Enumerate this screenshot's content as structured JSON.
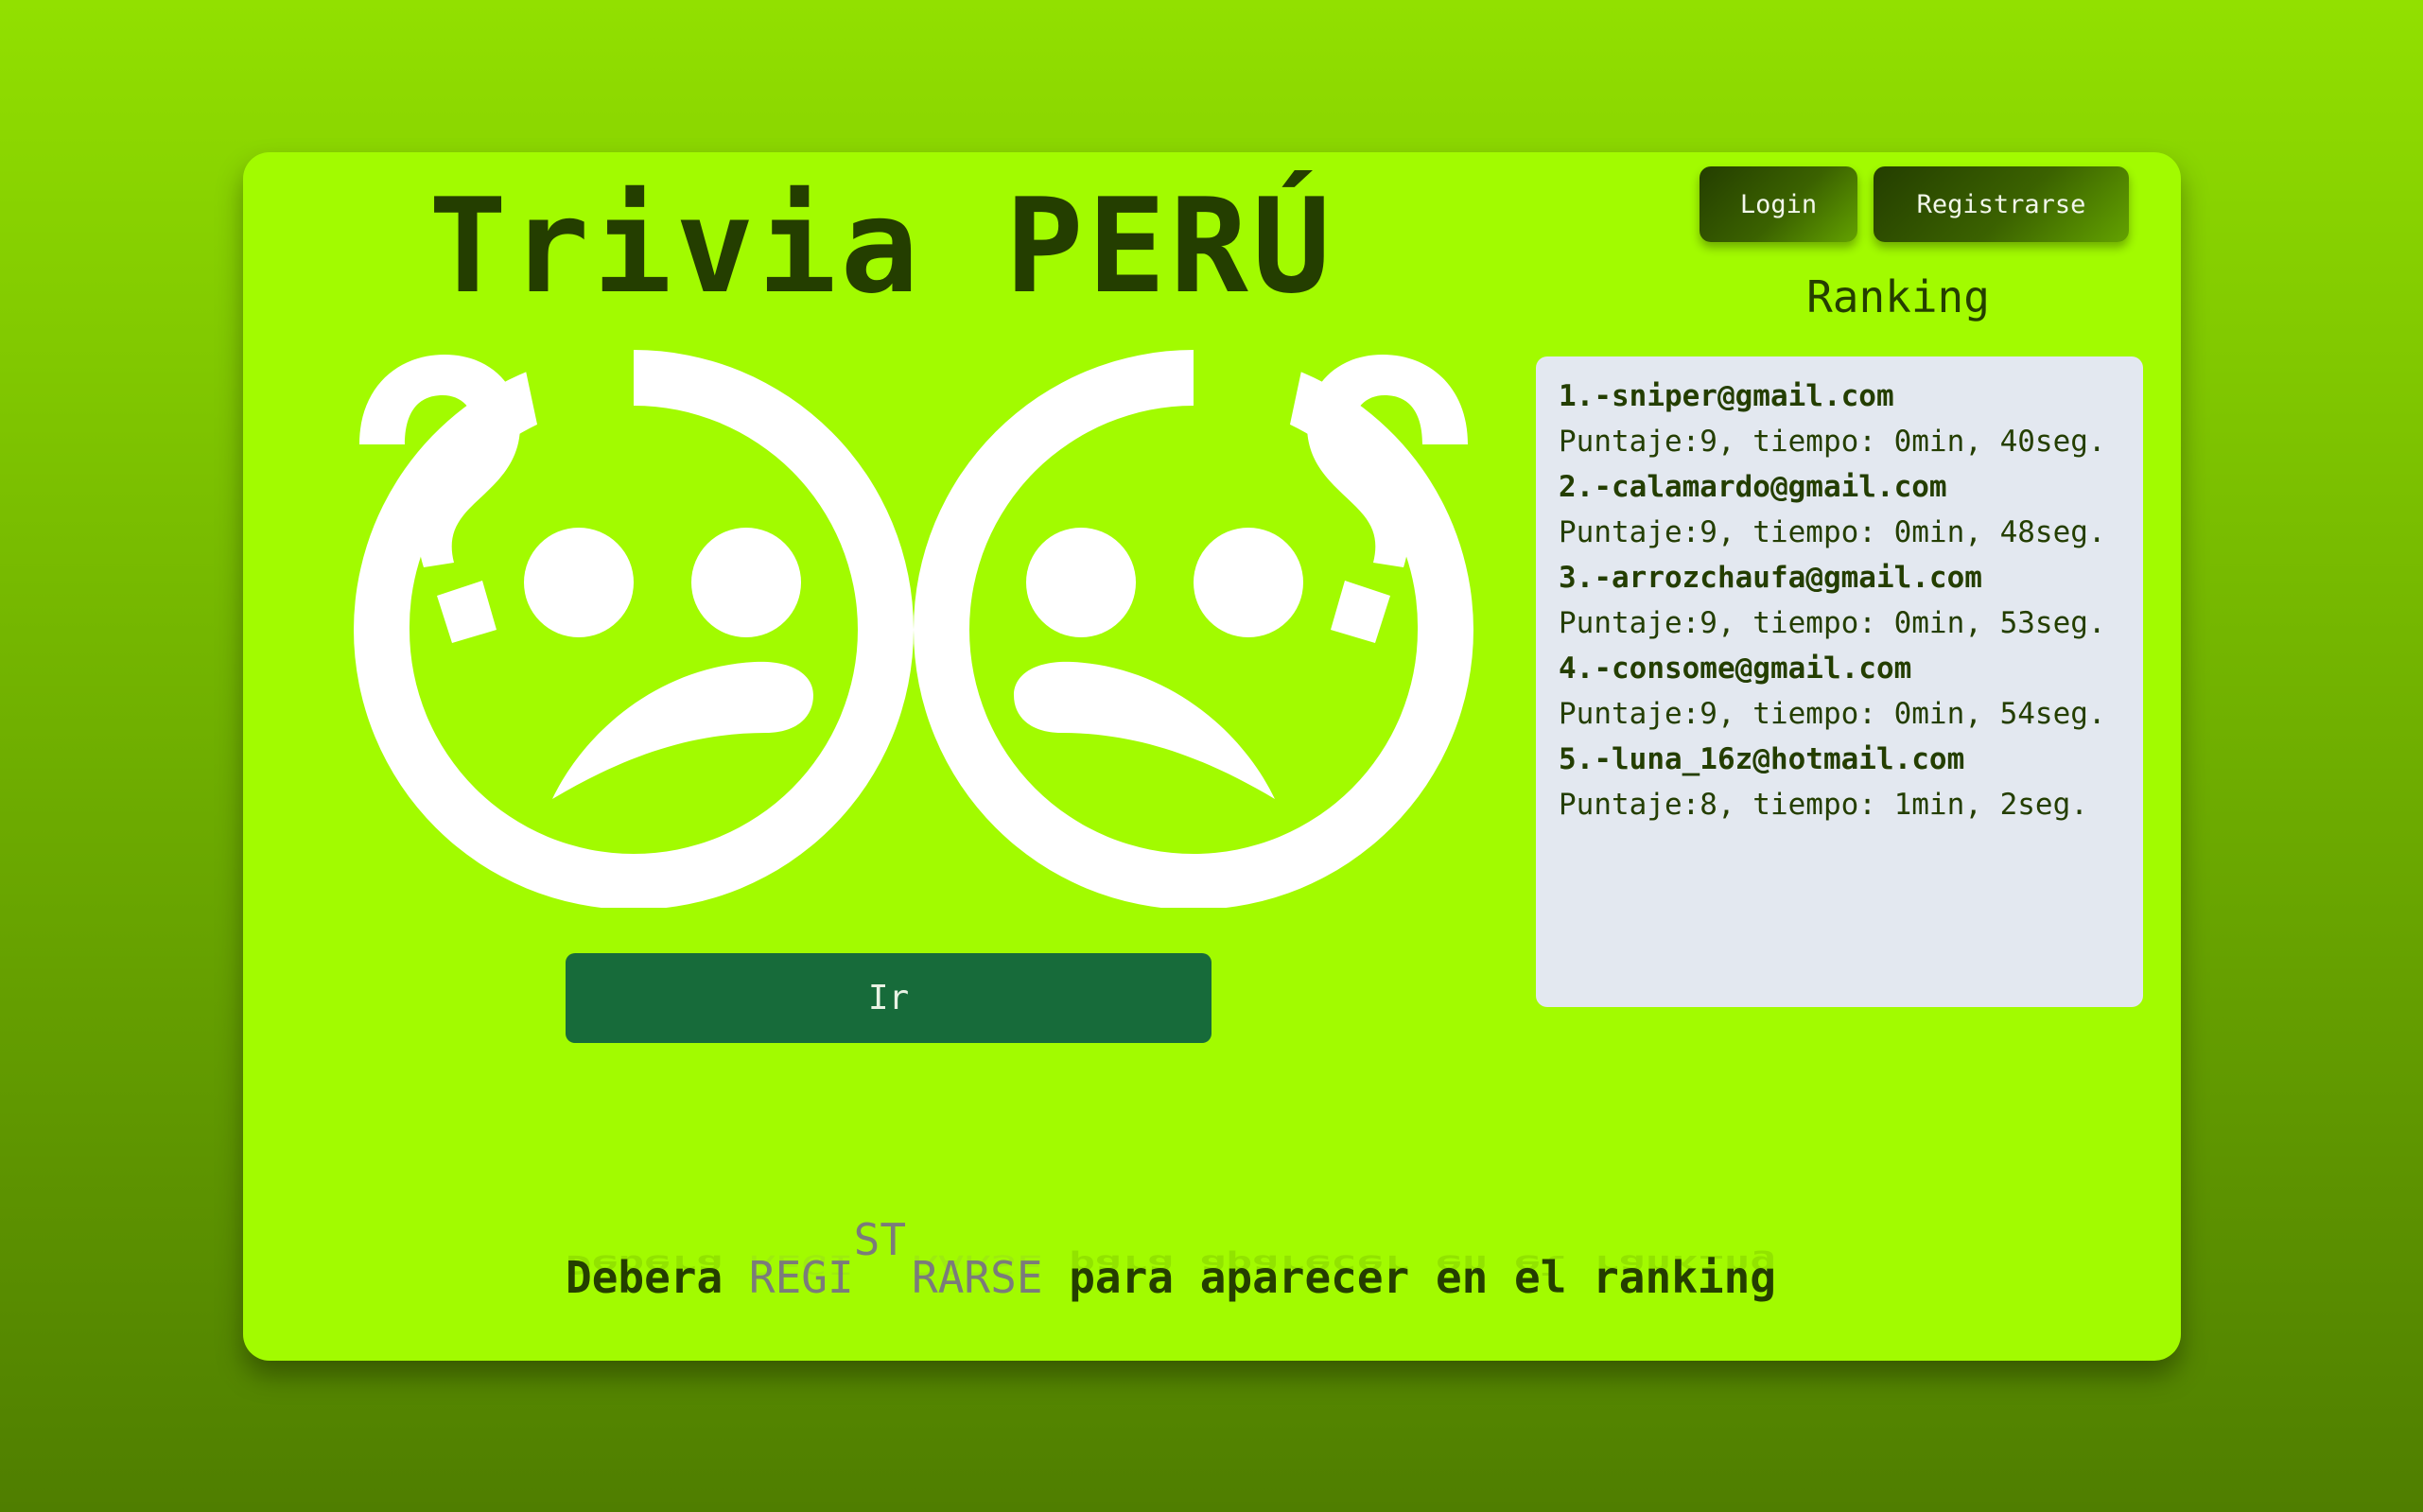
{
  "app": {
    "title": "Trivia PERÚ"
  },
  "nav": {
    "login_label": "Login",
    "register_label": "Registrarse"
  },
  "hero": {
    "icon": "confused-sad-faces-icon",
    "go_label": "Ir"
  },
  "ranking": {
    "title": "Ranking",
    "entries": [
      {
        "email": "1.-sniper@gmail.com",
        "score": "Puntaje:9, tiempo: 0min, 40seg."
      },
      {
        "email": "2.-calamardo@gmail.com",
        "score": "Puntaje:9, tiempo: 0min, 48seg."
      },
      {
        "email": "3.-arrozchaufa@gmail.com",
        "score": "Puntaje:9, tiempo: 0min, 53seg."
      },
      {
        "email": "4.-consome@gmail.com",
        "score": "Puntaje:9, tiempo: 0min, 54seg."
      },
      {
        "email": "5.-luna_16z@hotmail.com",
        "score": "Puntaje:8, tiempo: 1min, 2seg."
      }
    ]
  },
  "footer": {
    "before": "Debera ",
    "link_part1": "REGI",
    "link_part2": "ST",
    "link_part3": "RARSE",
    "after": " para aparecer en el ranking"
  },
  "colors": {
    "card_background": "#a2fb00",
    "title_text": "#243e00",
    "go_button": "#176b3a",
    "ranking_panel": "#e3e8f0",
    "link_text": "#7b7b7b"
  }
}
